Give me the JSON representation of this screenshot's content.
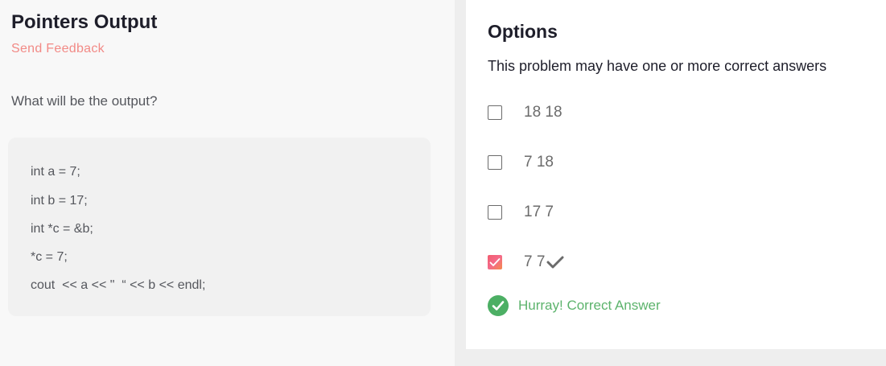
{
  "problem": {
    "title": "Pointers Output",
    "feedback_label": "Send Feedback",
    "question": "What will be the output?",
    "code_lines": [
      "int a = 7;",
      "int b = 17;",
      "int *c = &b;",
      "*c = 7;",
      "cout  << a << \"  “ << b << endl;"
    ]
  },
  "options": {
    "title": "Options",
    "subtitle": "This problem may have one or more correct answers",
    "items": [
      {
        "label": "18 18",
        "checked": false
      },
      {
        "label": "7 18",
        "checked": false
      },
      {
        "label": "17 7",
        "checked": false
      },
      {
        "label": "7 7",
        "checked": true,
        "correct": true
      }
    ]
  },
  "result": {
    "text": "Hurray! Correct Answer",
    "color": "#4caf64"
  },
  "colors": {
    "accent": "#f28a86",
    "success": "#4caf64"
  }
}
